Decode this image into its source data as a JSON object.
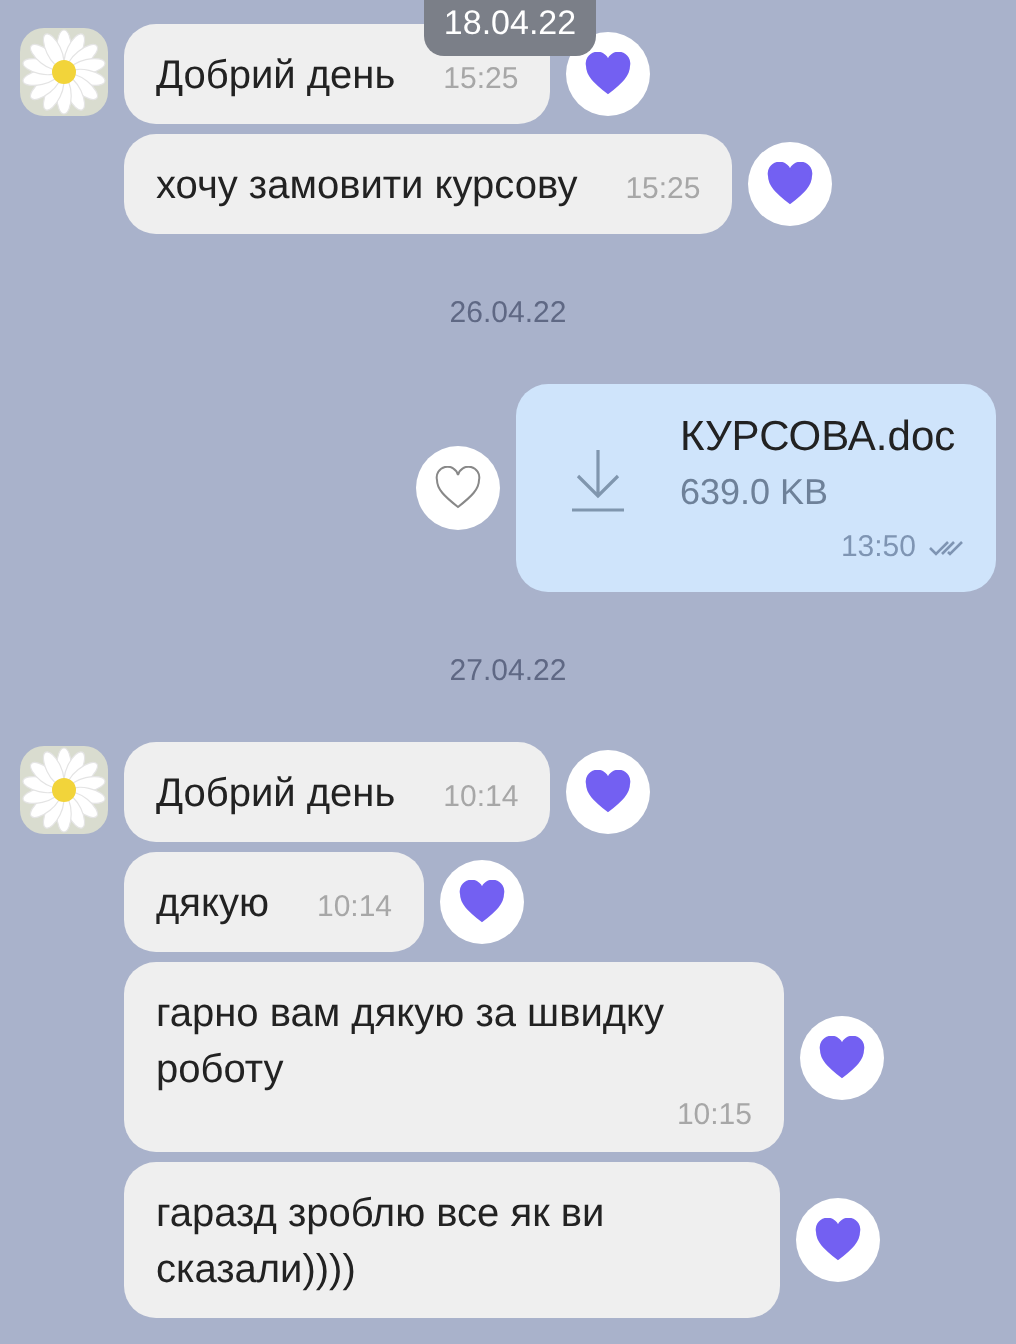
{
  "floating_date": "18.04.22",
  "items": [
    {
      "kind": "message",
      "avatar": true,
      "text": "Добрий день",
      "time": "15:25",
      "liked": true
    },
    {
      "kind": "message",
      "avatar": false,
      "text": "хочу замовити курсову",
      "time": "15:25",
      "liked": true
    },
    {
      "kind": "date",
      "text": "26.04.22"
    },
    {
      "kind": "file",
      "name": "КУРСОВА.doc",
      "size": "639.0 KB",
      "time": "13:50",
      "read": true,
      "liked": false
    },
    {
      "kind": "date",
      "text": "27.04.22"
    },
    {
      "kind": "message",
      "avatar": true,
      "text": "Добрий день",
      "time": "10:14",
      "liked": true
    },
    {
      "kind": "message",
      "avatar": false,
      "text": "дякую",
      "time": "10:14",
      "liked": true
    },
    {
      "kind": "message",
      "avatar": false,
      "text": "гарно вам дякую за швидку роботу",
      "time": "10:15",
      "liked": true
    },
    {
      "kind": "message",
      "avatar": false,
      "text": "гаразд зроблю все як ви сказали))))",
      "liked": true
    }
  ]
}
